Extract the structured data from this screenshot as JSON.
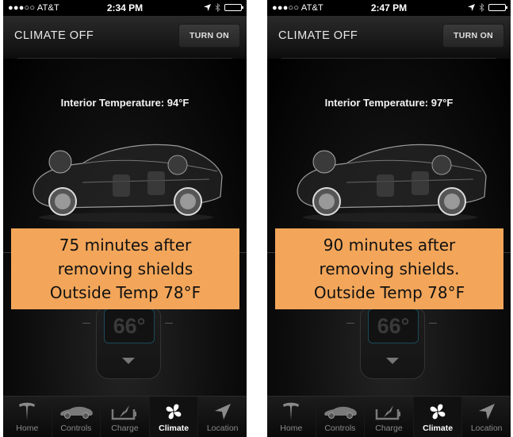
{
  "screens": [
    {
      "status_bar": {
        "carrier": "●●●○○ AT&T",
        "time": "2:34 PM"
      },
      "header": {
        "title": "CLIMATE OFF",
        "button_label": "TURN ON"
      },
      "interior_temperature": "Interior Temperature: 94°F",
      "set_temperature": "66°",
      "note": {
        "line1": "75 minutes after",
        "line2": "removing shields",
        "line3": "Outside Temp 78°F"
      },
      "tabs": [
        {
          "label": "Home",
          "icon": "tesla-logo-icon"
        },
        {
          "label": "Controls",
          "icon": "car-icon"
        },
        {
          "label": "Charge",
          "icon": "battery-charge-icon"
        },
        {
          "label": "Climate",
          "icon": "fan-icon",
          "active": true
        },
        {
          "label": "Location",
          "icon": "location-arrow-icon"
        }
      ]
    },
    {
      "status_bar": {
        "carrier": "●●●○○ AT&T",
        "time": "2:47 PM"
      },
      "header": {
        "title": "CLIMATE OFF",
        "button_label": "TURN ON"
      },
      "interior_temperature": "Interior Temperature: 97°F",
      "set_temperature": "66°",
      "note": {
        "line1": "90 minutes after",
        "line2": "removing shields.",
        "line3": "Outside Temp 78°F"
      },
      "tabs": [
        {
          "label": "Home",
          "icon": "tesla-logo-icon"
        },
        {
          "label": "Controls",
          "icon": "car-icon"
        },
        {
          "label": "Charge",
          "icon": "battery-charge-icon"
        },
        {
          "label": "Climate",
          "icon": "fan-icon",
          "active": true
        },
        {
          "label": "Location",
          "icon": "location-arrow-icon"
        }
      ]
    }
  ],
  "colors": {
    "note_background": "#f3a65a",
    "app_background": "#000000",
    "active_tab_text": "#ffffff",
    "inactive_tab_text": "#8a8a8a"
  }
}
